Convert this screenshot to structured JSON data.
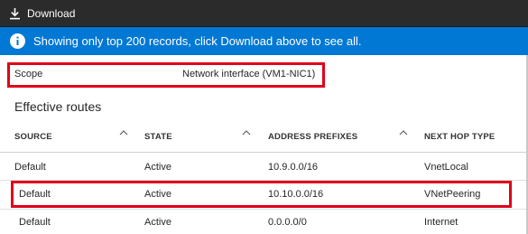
{
  "toolbar": {
    "download_label": "Download"
  },
  "banner": {
    "message": "Showing only top 200 records, click Download above to see all."
  },
  "scope": {
    "label": "Scope",
    "value": "Network interface (VM1-NIC1)"
  },
  "section_title": "Effective routes",
  "table": {
    "headers": [
      "SOURCE",
      "STATE",
      "ADDRESS PREFIXES",
      "NEXT HOP TYPE"
    ],
    "rows": [
      [
        "Default",
        "Active",
        "10.9.0.0/16",
        "VnetLocal"
      ],
      [
        "Default",
        "Active",
        "10.10.0.0/16",
        "VNetPeering"
      ],
      [
        "Default",
        "Active",
        "0.0.0.0/0",
        "Internet"
      ]
    ]
  },
  "colors": {
    "toolbar_bg": "#2b2b2b",
    "banner_bg": "#0078d4",
    "highlight": "#e0001b"
  }
}
